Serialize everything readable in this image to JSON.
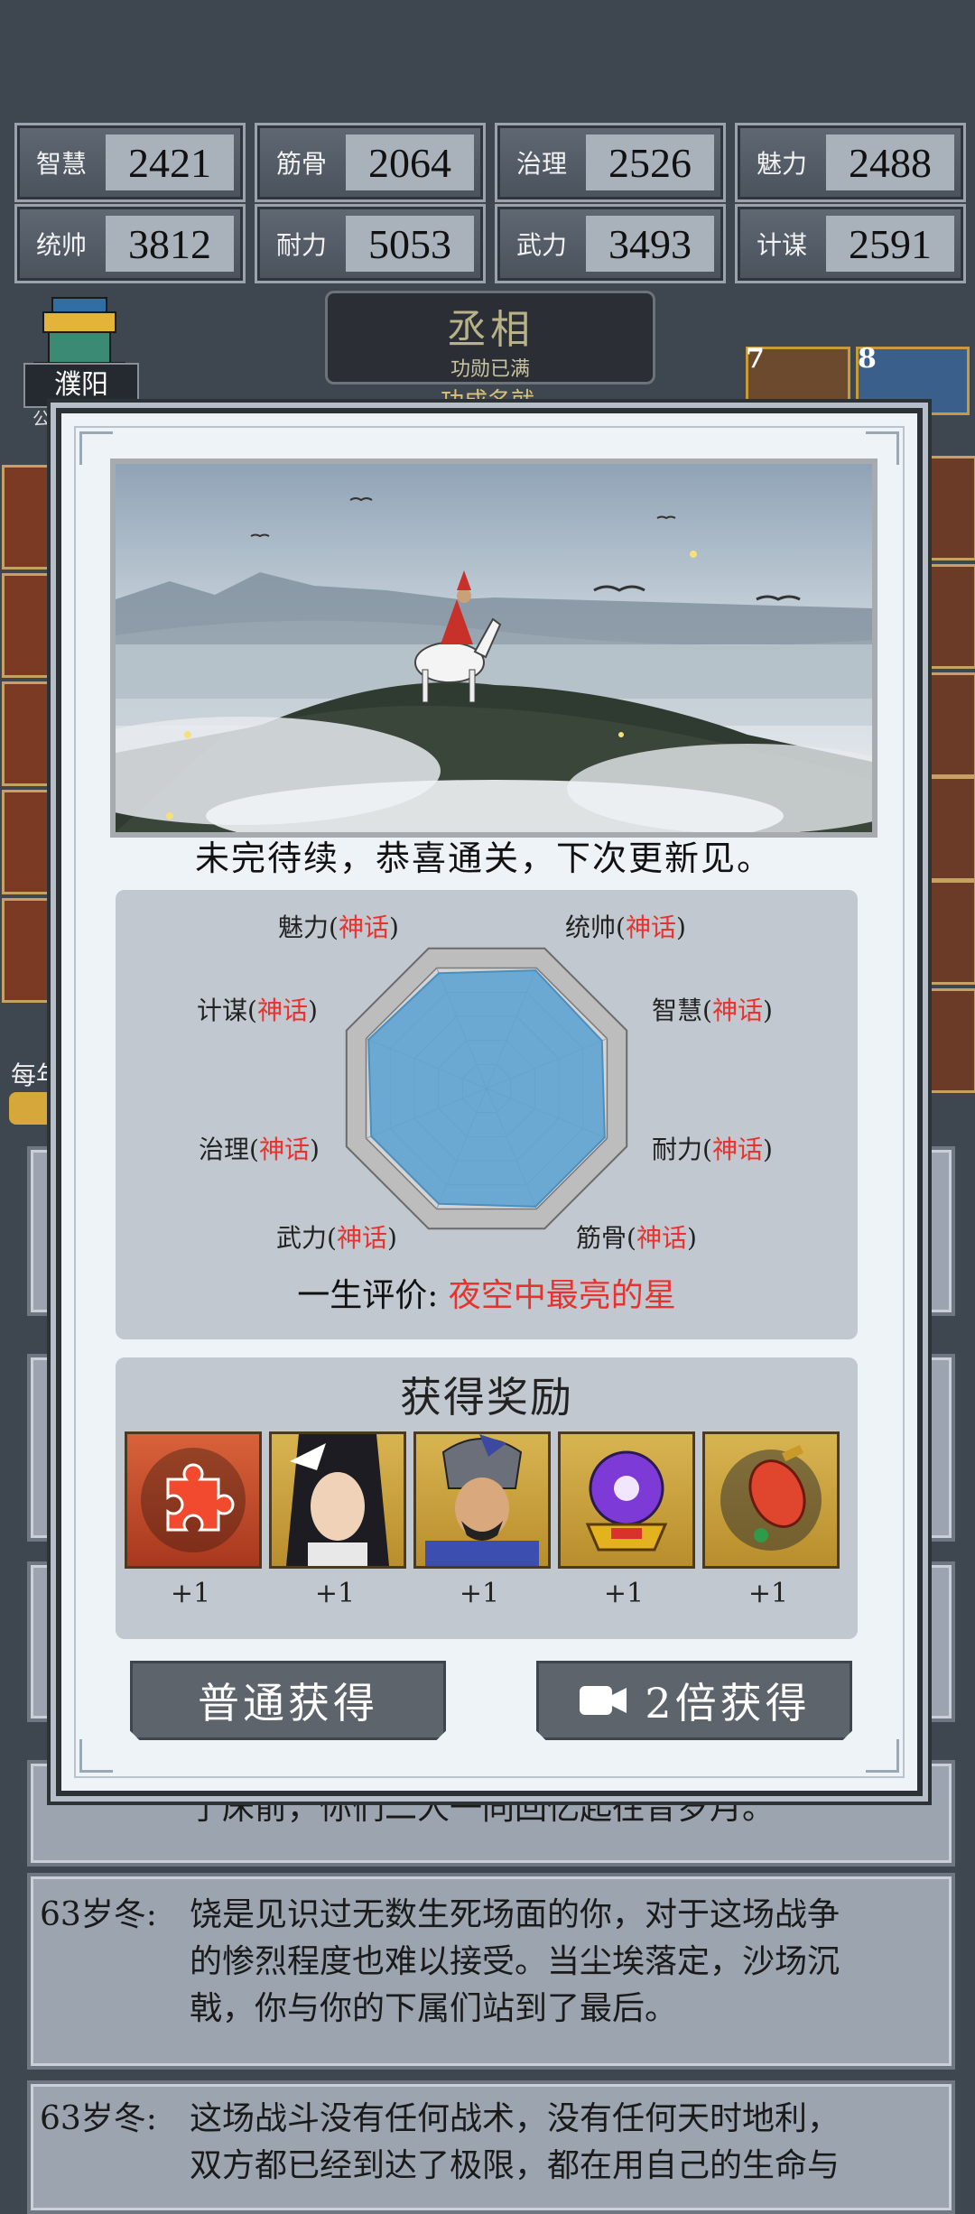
{
  "stats": [
    {
      "label": "智慧",
      "value": "2421"
    },
    {
      "label": "筋骨",
      "value": "2064"
    },
    {
      "label": "治理",
      "value": "2526"
    },
    {
      "label": "魅力",
      "value": "2488"
    },
    {
      "label": "统帅",
      "value": "3812"
    },
    {
      "label": "耐力",
      "value": "5053"
    },
    {
      "label": "武力",
      "value": "3493"
    },
    {
      "label": "计谋",
      "value": "2591"
    }
  ],
  "city": {
    "name": "濮阳",
    "sub": "公"
  },
  "rank": {
    "title": "丞相",
    "subtitle": "功勋已满",
    "under": "功成名就"
  },
  "side_badges": {
    "right_1": "7",
    "right_2": "8",
    "left_label": "每年"
  },
  "modal": {
    "message": "未完待续，恭喜通关，下次更新见。",
    "radar": {
      "labels": [
        {
          "name": "魅力",
          "grade": "神话"
        },
        {
          "name": "统帅",
          "grade": "神话"
        },
        {
          "name": "计谋",
          "grade": "神话"
        },
        {
          "name": "智慧",
          "grade": "神话"
        },
        {
          "name": "治理",
          "grade": "神话"
        },
        {
          "name": "耐力",
          "grade": "神话"
        },
        {
          "name": "武力",
          "grade": "神话"
        },
        {
          "name": "筋骨",
          "grade": "神话"
        }
      ],
      "open_paren": "(",
      "close_paren": ")",
      "fill_color": "#5fa4d2"
    },
    "evaluation": {
      "label": "一生评价: ",
      "value": "夜空中最亮的星"
    },
    "rewards": {
      "title": "获得奖励",
      "items": [
        {
          "icon": "puzzle-icon",
          "count": "+1"
        },
        {
          "icon": "female-hero-portrait",
          "count": "+1"
        },
        {
          "icon": "general-portrait",
          "count": "+1"
        },
        {
          "icon": "crystal-orb-icon",
          "count": "+1"
        },
        {
          "icon": "red-lantern-icon",
          "count": "+1"
        }
      ]
    },
    "buttons": {
      "normal": "普通获得",
      "double": "2倍获得"
    }
  },
  "log": {
    "line_bottom_partial": "了床前，你们二人一同回忆起往昔岁月。",
    "entry1_age": "63岁冬:",
    "entry1_l1": "饶是见识过无数生死场面的你，对于这场战争",
    "entry1_l2": "的惨烈程度也难以接受。当尘埃落定，沙场沉",
    "entry1_l3": "戟，你与你的下属们站到了最后。",
    "entry2_age": "63岁冬:",
    "entry2_l1": "这场战斗没有任何战术，没有任何天时地利，",
    "entry2_l2": "双方都已经到达了极限，都在用自己的生命与"
  },
  "colors": {
    "accent_red": "#e8322e",
    "panel": "#c2c8d0",
    "button": "#5d646c"
  }
}
